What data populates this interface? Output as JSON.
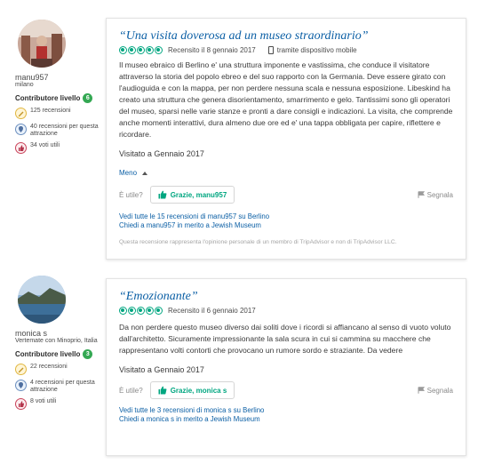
{
  "reviews": [
    {
      "reviewer": {
        "name": "manu957",
        "location": "milano",
        "level_label": "Contributore livello",
        "level": "6",
        "stats": [
          {
            "icon": "pencil-icon",
            "text": "125 recensioni"
          },
          {
            "icon": "location-pin-icon",
            "text": "40 recensioni per questa attrazione"
          },
          {
            "icon": "thumbs-up-icon",
            "text": "34 voti utili"
          }
        ]
      },
      "title": "“Una visita doverosa ad un museo straordinario”",
      "rating": 5,
      "date": "Recensito il 8 gennaio 2017",
      "device": "tramite dispositivo mobile",
      "body": "Il museo ebraico di Berlino e' una struttura imponente e vastissima, che conduce il visitatore attraverso la storia del popolo ebreo e del suo rapporto con la Germania. Deve essere girato con l'audioguida e con la mappa, per non perdere nessuna scala e nessuna esposizione. Libeskind ha creato una struttura che genera disorientamento, smarrimento e gelo. Tantissimi sono gli operatori del museo, sparsi nelle varie stanze e pronti a dare consigli e indicazioni. La visita, che comprende anche momenti interattivi, dura almeno due ore ed e' una tappa obbligata per capire, riflettere e ricordare.",
      "visited": "Visitato a Gennaio 2017",
      "less_label": "Meno",
      "useful_label": "È utile?",
      "thanks_label": "Grazie, manu957",
      "report_label": "Segnala",
      "link_all": "Vedi tutte le 15 recensioni di manu957 su Berlino",
      "link_ask": "Chiedi a manu957 in merito a Jewish Museum",
      "disclaimer": "Questa recensione rappresenta l'opinione personale di un membro di TripAdvisor e non di TripAdvisor LLC."
    },
    {
      "reviewer": {
        "name": "monica s",
        "location": "Vertemate con Minoprio, Italia",
        "level_label": "Contributore livello",
        "level": "3",
        "stats": [
          {
            "icon": "pencil-icon",
            "text": "22 recensioni"
          },
          {
            "icon": "location-pin-icon",
            "text": "4 recensioni per questa attrazione"
          },
          {
            "icon": "thumbs-up-icon",
            "text": "8 voti utili"
          }
        ]
      },
      "title": "“Emozionante”",
      "rating": 5,
      "date": "Recensito il 6 gennaio 2017",
      "body": "Da non perdere questo museo diverso dai soliti dove i ricordi si affiancano al senso di vuoto voluto dall'architetto. Sicuramente impressionante la sala scura in cui si cammina su macchere che rappresentano volti contorti che provocano un rumore sordo e straziante. Da vedere",
      "visited": "Visitato a Gennaio 2017",
      "useful_label": "È utile?",
      "thanks_label": "Grazie, monica s",
      "report_label": "Segnala",
      "link_all": "Vedi tutte le 3 recensioni di monica s su Berlino",
      "link_ask": "Chiedi a monica s in merito a Jewish Museum"
    }
  ]
}
